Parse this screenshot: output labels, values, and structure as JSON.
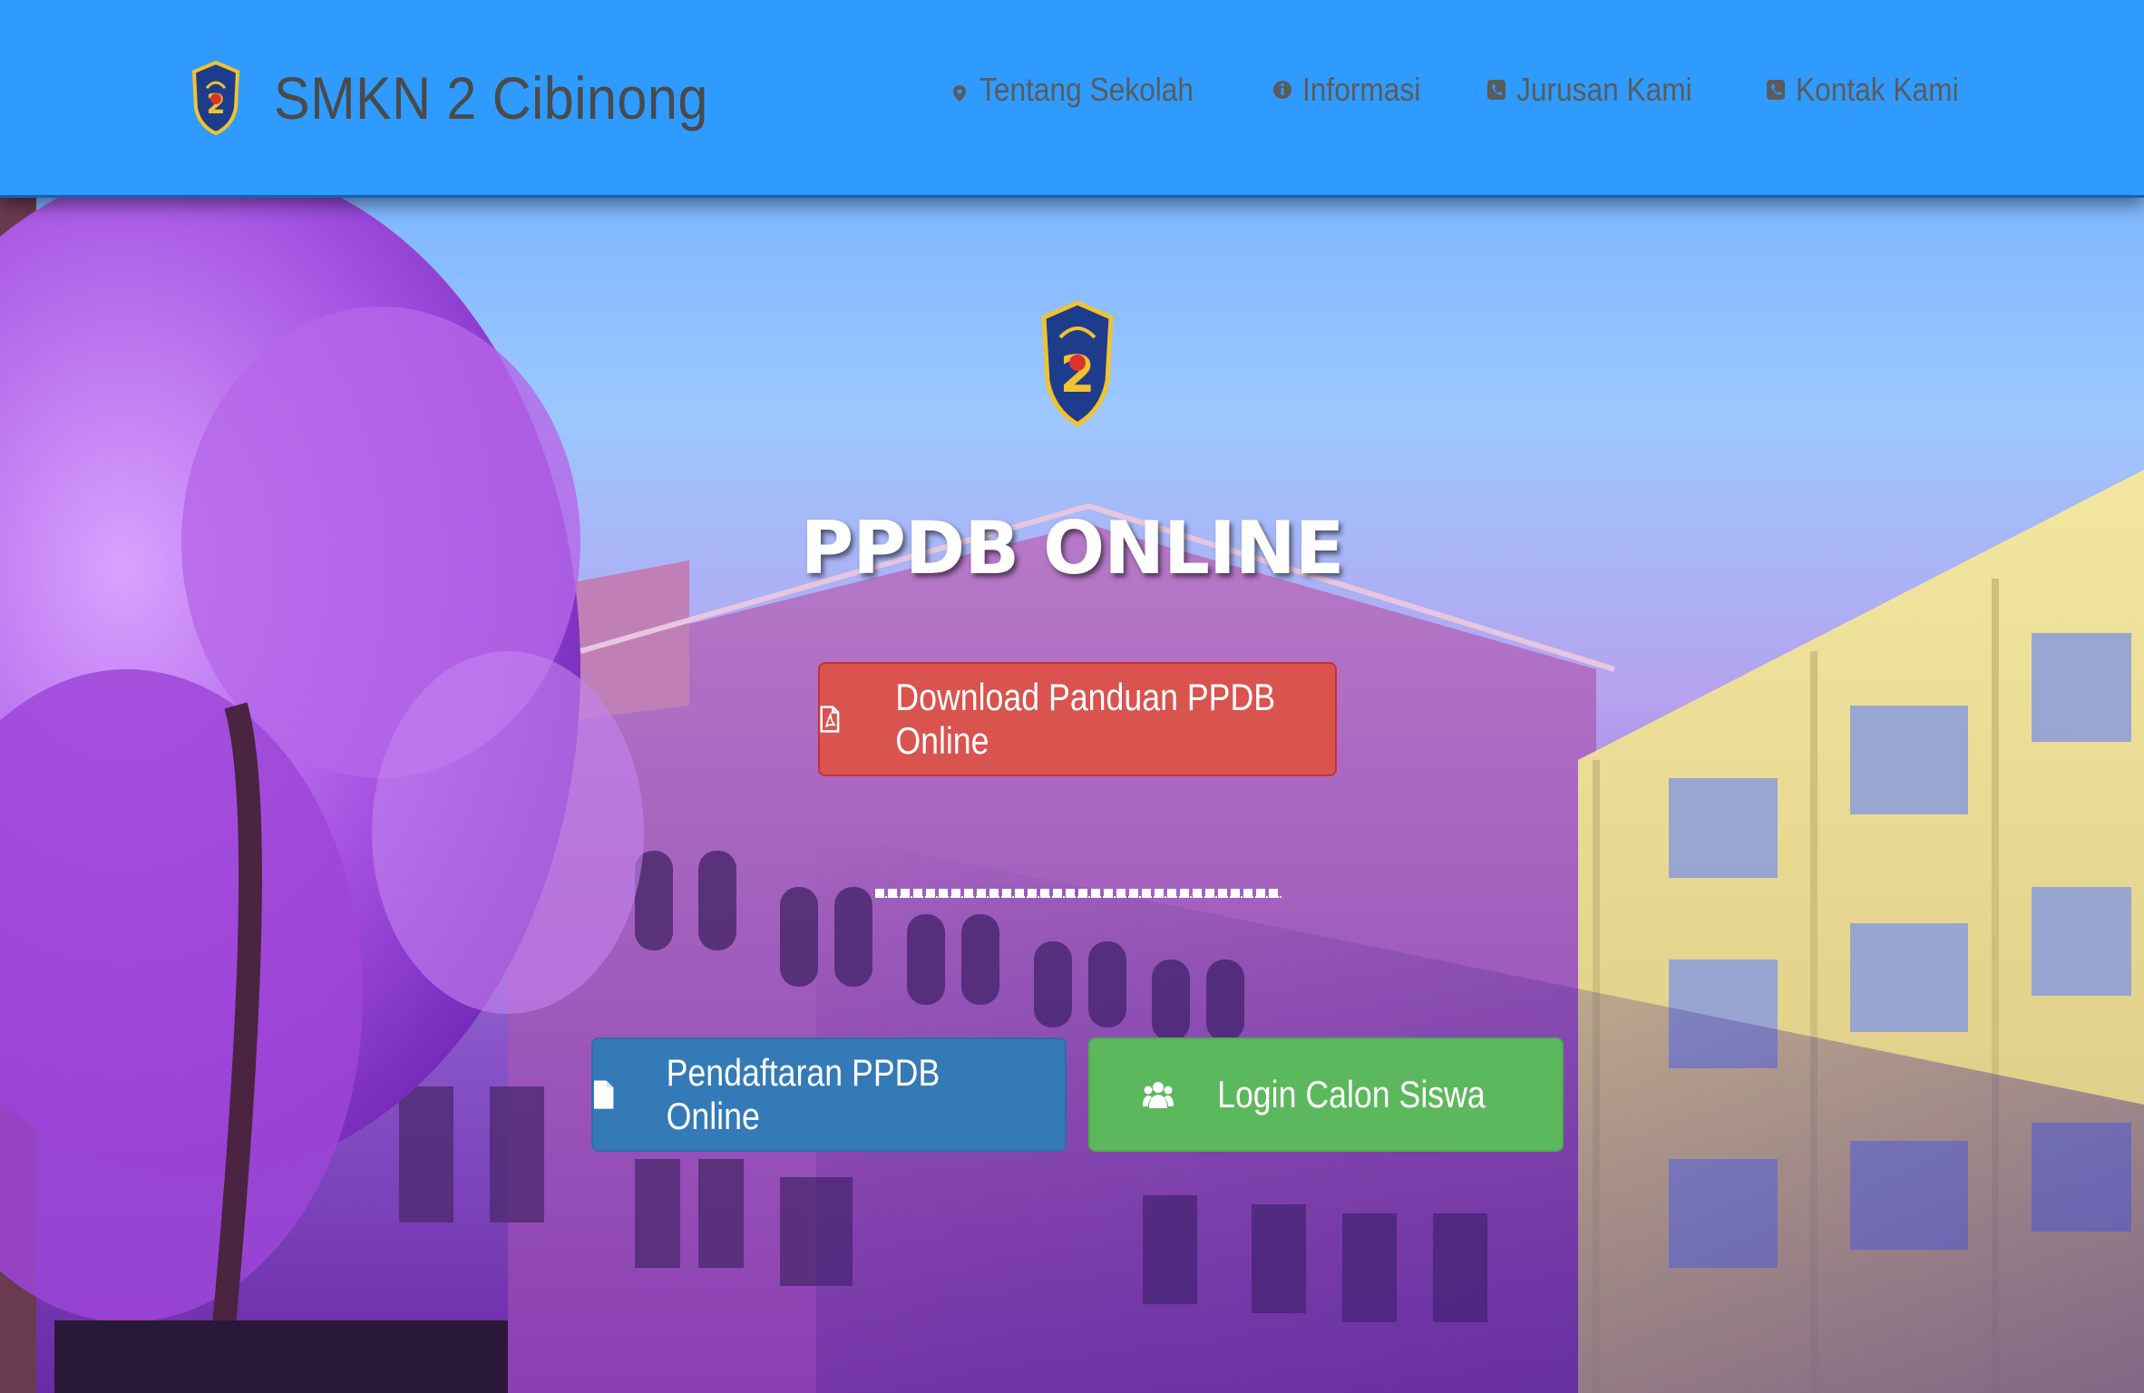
{
  "colors": {
    "navbar_bg": "#2f9bff",
    "download_button": "#d9534f",
    "register_button": "#337ab7",
    "login_button": "#5cb85c"
  },
  "navbar": {
    "brand_logo_icon": "school-crest-icon",
    "brand_name": "SMKN 2 Cibinong",
    "links": [
      {
        "icon": "map-marker-icon",
        "label": "Tentang Sekolah"
      },
      {
        "icon": "info-circle-icon",
        "label": "Informasi"
      },
      {
        "icon": "phone-square-icon",
        "label": "Jurusan Kami"
      },
      {
        "icon": "phone-square-icon",
        "label": "Kontak Kami"
      }
    ]
  },
  "hero": {
    "logo_icon": "school-crest-icon",
    "title": "PPDB ONLINE",
    "download_button": {
      "icon": "file-pdf-icon",
      "label": "Download Panduan PPDB Online"
    },
    "register_button": {
      "icon": "file-icon",
      "label": "Pendaftaran PPDB Online"
    },
    "login_button": {
      "icon": "users-icon",
      "label": "Login Calon Siswa"
    }
  }
}
